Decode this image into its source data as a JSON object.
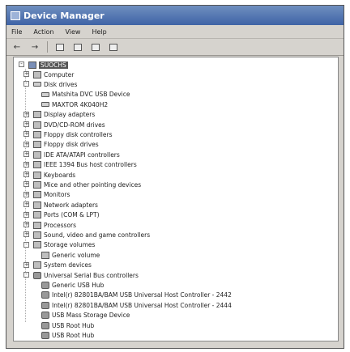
{
  "window": {
    "title": "Device Manager"
  },
  "menu": [
    "File",
    "Action",
    "View",
    "Help"
  ],
  "toolbar": {
    "buttons": [
      "back-icon",
      "forward-icon",
      "properties-icon",
      "print-icon",
      "help-icon",
      "scan-icon"
    ]
  },
  "tree": {
    "root": {
      "label": "SUOCHS"
    },
    "nodes": [
      {
        "label": "Computer",
        "level": 1,
        "expander": "+",
        "icon": "computer-icon"
      },
      {
        "label": "Disk drives",
        "level": 1,
        "expander": "-",
        "icon": "disk-icon"
      },
      {
        "label": "Matshita DVC USB Device",
        "level": 2,
        "expander": "",
        "icon": "disk-icon"
      },
      {
        "label": "MAXTOR 4K040H2",
        "level": 2,
        "expander": "",
        "icon": "disk-icon"
      },
      {
        "label": "Display adapters",
        "level": 1,
        "expander": "+",
        "icon": "display-icon"
      },
      {
        "label": "DVD/CD-ROM drives",
        "level": 1,
        "expander": "+",
        "icon": "dvd-icon"
      },
      {
        "label": "Floppy disk controllers",
        "level": 1,
        "expander": "+",
        "icon": "floppy-controller-icon"
      },
      {
        "label": "Floppy disk drives",
        "level": 1,
        "expander": "+",
        "icon": "floppy-icon"
      },
      {
        "label": "IDE ATA/ATAPI controllers",
        "level": 1,
        "expander": "+",
        "icon": "ide-icon"
      },
      {
        "label": "IEEE 1394 Bus host controllers",
        "level": 1,
        "expander": "+",
        "icon": "firewire-icon"
      },
      {
        "label": "Keyboards",
        "level": 1,
        "expander": "+",
        "icon": "keyboard-icon"
      },
      {
        "label": "Mice and other pointing devices",
        "level": 1,
        "expander": "+",
        "icon": "mouse-icon"
      },
      {
        "label": "Monitors",
        "level": 1,
        "expander": "+",
        "icon": "monitor-icon"
      },
      {
        "label": "Network adapters",
        "level": 1,
        "expander": "+",
        "icon": "network-icon"
      },
      {
        "label": "Ports (COM & LPT)",
        "level": 1,
        "expander": "+",
        "icon": "port-icon"
      },
      {
        "label": "Processors",
        "level": 1,
        "expander": "+",
        "icon": "processor-icon"
      },
      {
        "label": "Sound, video and game controllers",
        "level": 1,
        "expander": "+",
        "icon": "sound-icon"
      },
      {
        "label": "Storage volumes",
        "level": 1,
        "expander": "-",
        "icon": "storage-icon"
      },
      {
        "label": "Generic volume",
        "level": 2,
        "expander": "",
        "icon": "storage-icon"
      },
      {
        "label": "System devices",
        "level": 1,
        "expander": "+",
        "icon": "system-icon"
      },
      {
        "label": "Universal Serial Bus controllers",
        "level": 1,
        "expander": "-",
        "icon": "usb-icon"
      },
      {
        "label": "Generic USB Hub",
        "level": 2,
        "expander": "",
        "icon": "usb-icon"
      },
      {
        "label": "Intel(r) 82801BA/BAM USB Universal Host Controller - 2442",
        "level": 2,
        "expander": "",
        "icon": "usb-icon"
      },
      {
        "label": "Intel(r) 82801BA/BAM USB Universal Host Controller - 2444",
        "level": 2,
        "expander": "",
        "icon": "usb-icon"
      },
      {
        "label": "USB Mass Storage Device",
        "level": 2,
        "expander": "",
        "icon": "usb-icon"
      },
      {
        "label": "USB Root Hub",
        "level": 2,
        "expander": "",
        "icon": "usb-icon"
      },
      {
        "label": "USB Root Hub",
        "level": 2,
        "expander": "",
        "icon": "usb-icon"
      }
    ]
  }
}
